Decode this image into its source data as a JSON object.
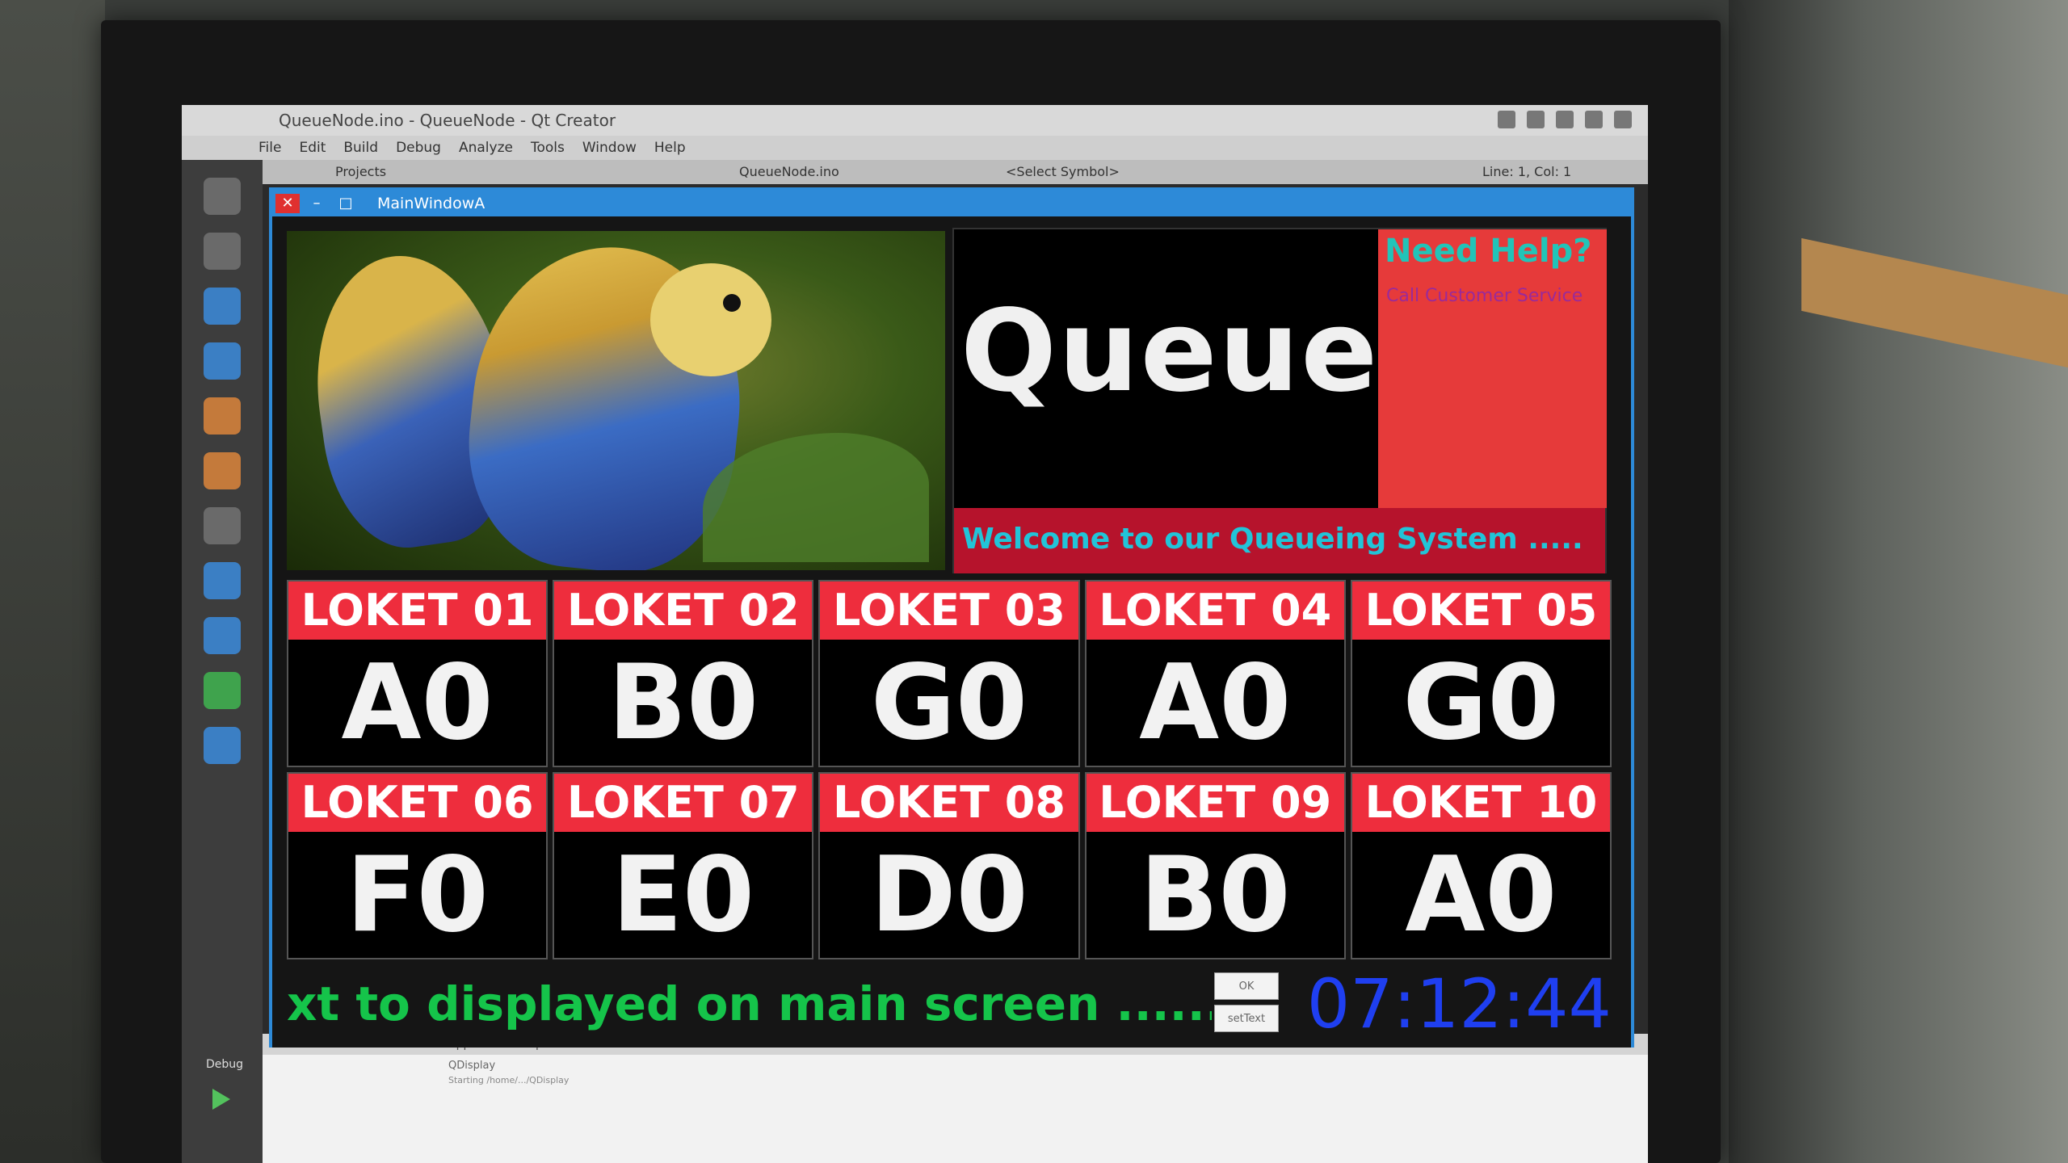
{
  "qt": {
    "title": "QueueNode.ino - QueueNode - Qt Creator",
    "menu": [
      "File",
      "Edit",
      "Build",
      "Debug",
      "Analyze",
      "Tools",
      "Window",
      "Help"
    ],
    "projects_label": "Projects",
    "file_label": "QueueNode.ino",
    "symbol_label": "<Select Symbol>",
    "linecol": "Line: 1, Col: 1",
    "debug_label": "Debug",
    "output_tab": "Application Output",
    "output_process": "QDisplay",
    "output_line": "Starting /home/.../QDisplay"
  },
  "app": {
    "window_title": "MainWindowA",
    "queue_title": "Queue!",
    "help_title": "Need Help?",
    "help_sub": "Call Customer Service",
    "welcome": "Welcome to our Queueing System .....",
    "counters": [
      {
        "label": "LOKET 01",
        "value": "A0"
      },
      {
        "label": "LOKET 02",
        "value": "B0"
      },
      {
        "label": "LOKET 03",
        "value": "G0"
      },
      {
        "label": "LOKET 04",
        "value": "A0"
      },
      {
        "label": "LOKET 05",
        "value": "G0"
      },
      {
        "label": "LOKET 06",
        "value": "F0"
      },
      {
        "label": "LOKET 07",
        "value": "E0"
      },
      {
        "label": "LOKET 08",
        "value": "D0"
      },
      {
        "label": "LOKET 09",
        "value": "B0"
      },
      {
        "label": "LOKET 10",
        "value": "A0"
      }
    ],
    "ticker": "xt to displayed on main screen ............Go",
    "button_ok": "OK",
    "button_set": "setText",
    "clock": "07:12:44"
  },
  "colors": {
    "counter_header": "#ee2d3d",
    "help_box": "#e63a3a",
    "welcome_text": "#22c4d8",
    "ticker": "#15c44a",
    "clock": "#1f3ff0",
    "titlebar": "#2d8ad8"
  }
}
